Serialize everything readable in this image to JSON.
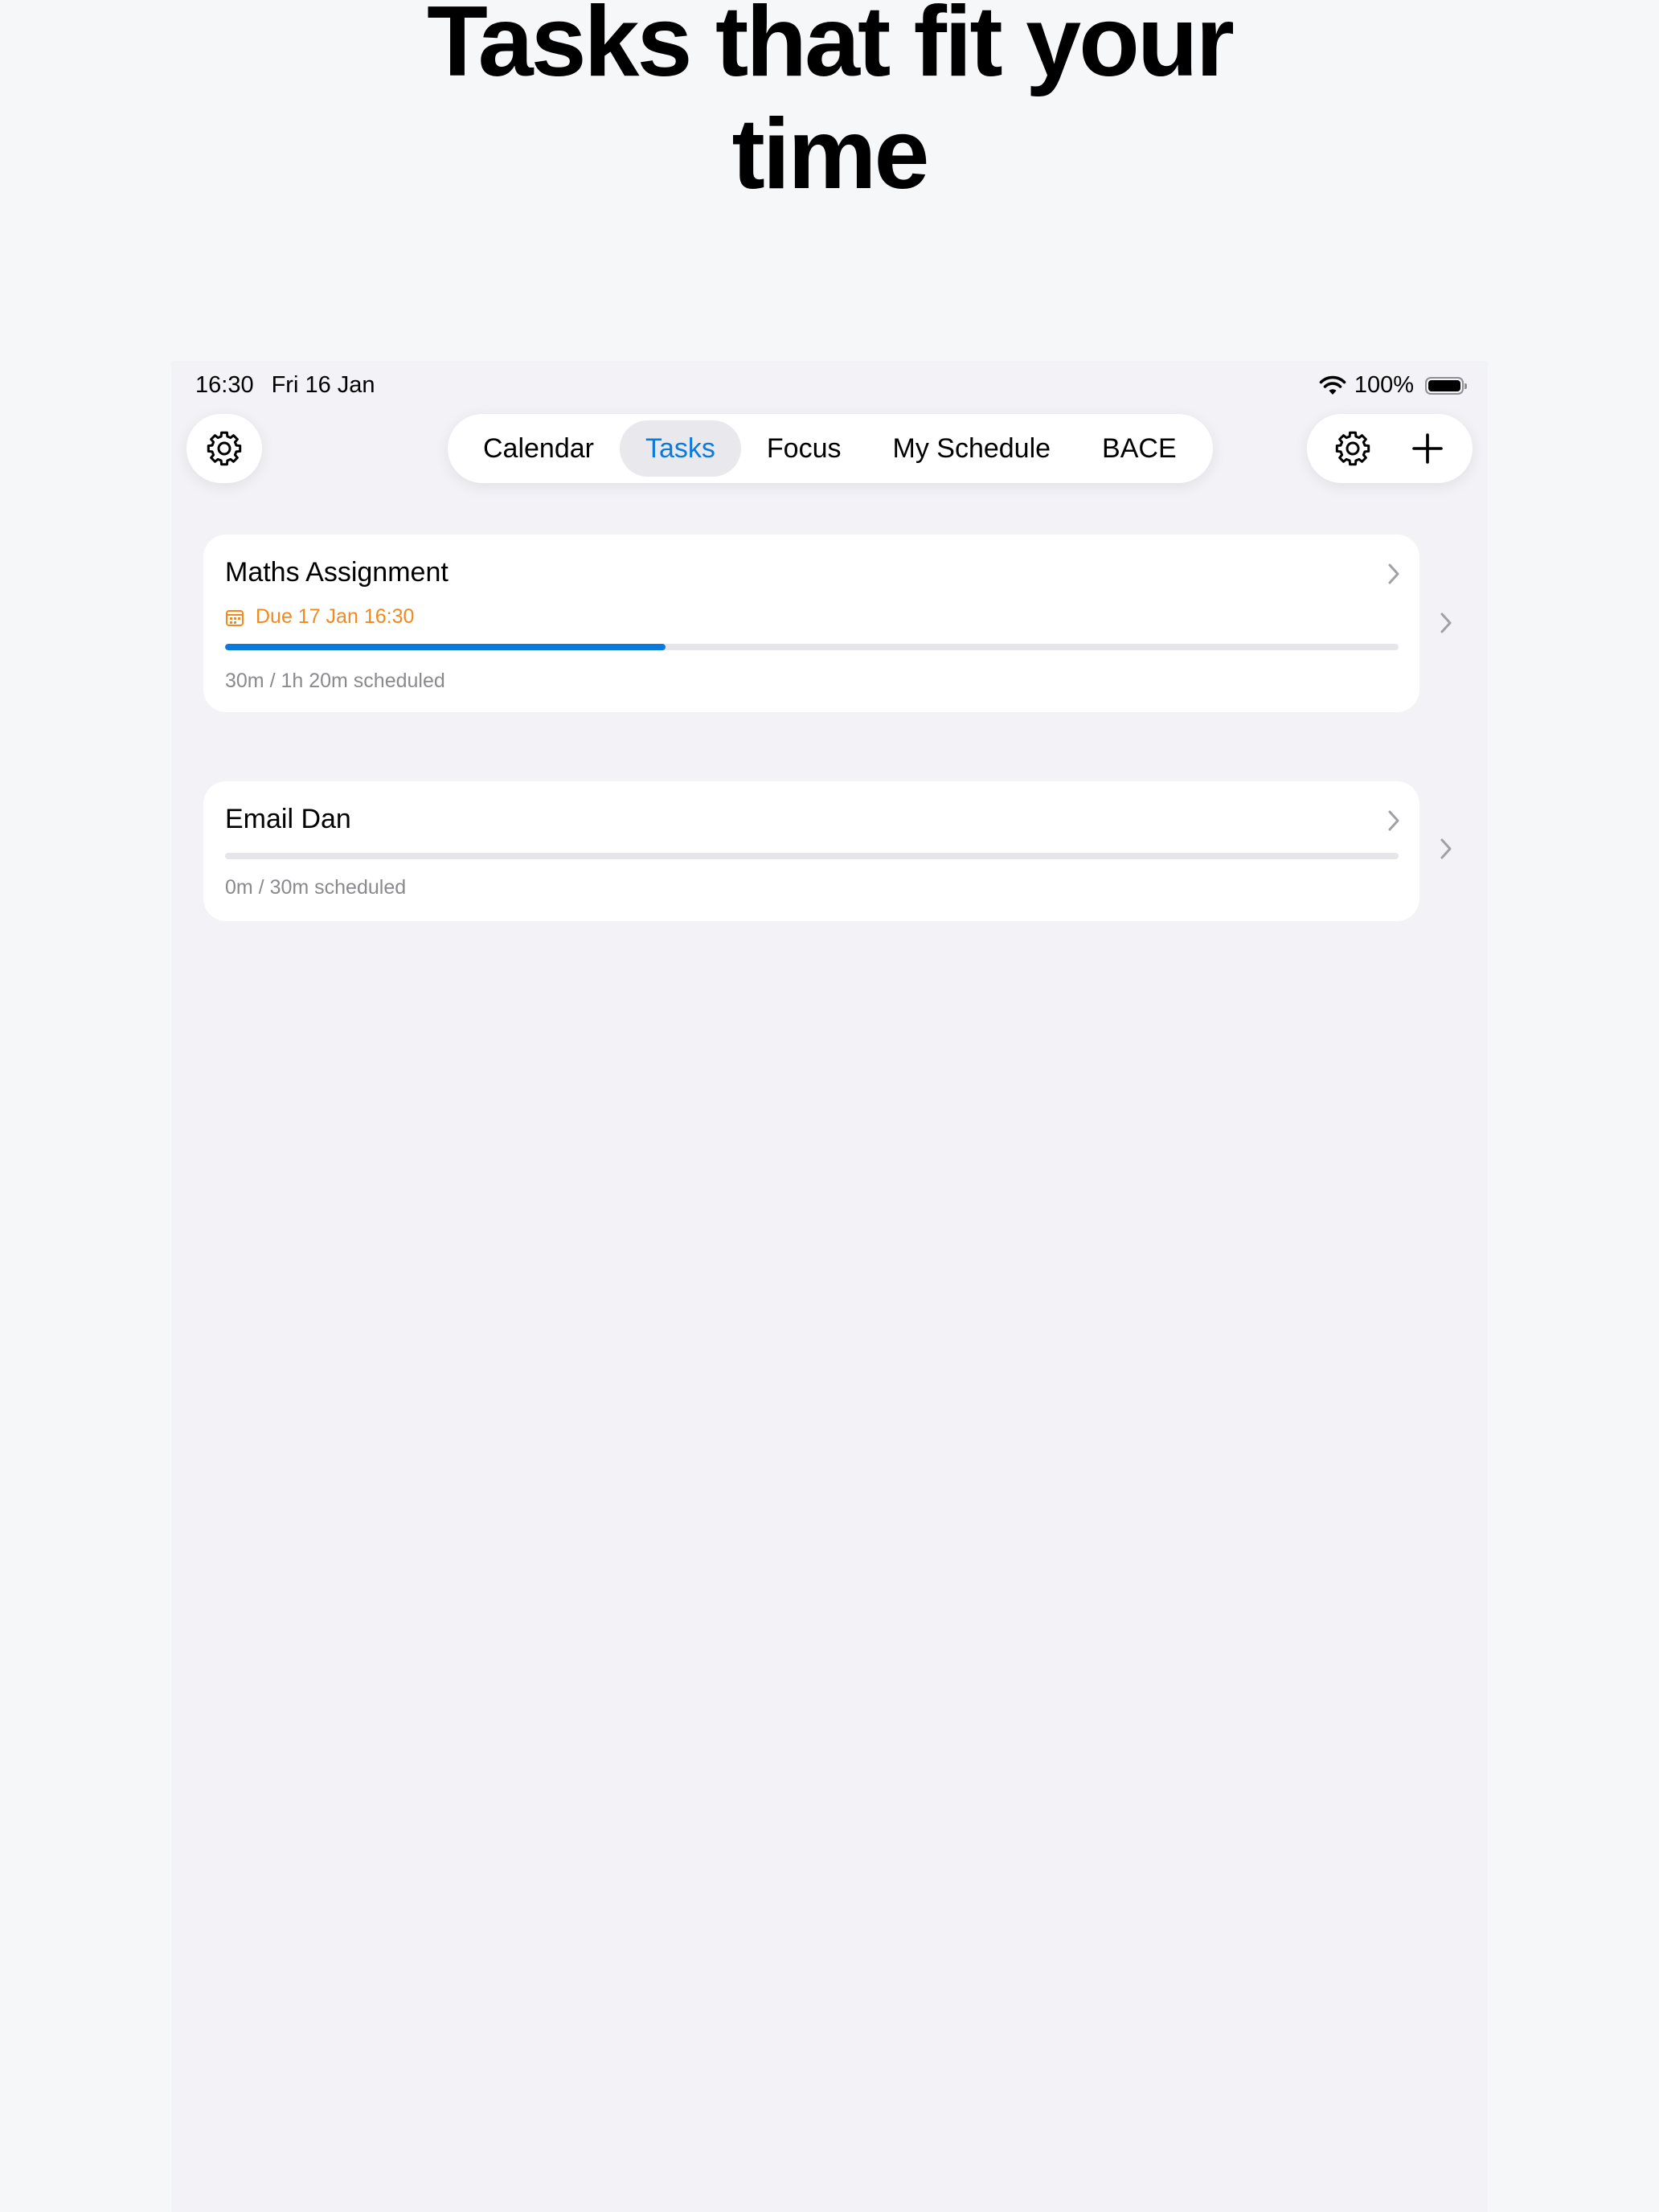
{
  "headline": {
    "line1": "Tasks that fit your",
    "line2": "time"
  },
  "status_bar": {
    "time": "16:30",
    "date": "Fri 16 Jan",
    "battery": "100%"
  },
  "icons": {
    "settings_left": "gear-icon",
    "settings_right": "gear-icon",
    "add": "plus-icon",
    "chevron": "chevron-right-icon",
    "calendar": "calendar-icon",
    "wifi": "wifi-icon",
    "battery": "battery-icon"
  },
  "tabs": [
    {
      "label": "Calendar",
      "active": false
    },
    {
      "label": "Tasks",
      "active": true
    },
    {
      "label": "Focus",
      "active": false
    },
    {
      "label": "My Schedule",
      "active": false
    },
    {
      "label": "BACE",
      "active": false
    }
  ],
  "colors": {
    "accent": "#0a7bdc",
    "due": "#f0891f",
    "secondary_text": "#8a8a8e"
  },
  "tasks": [
    {
      "title": "Maths Assignment",
      "due": "Due 17 Jan  16:30",
      "progress": 0.375,
      "scheduled": "30m / 1h 20m scheduled"
    },
    {
      "title": "Email Dan",
      "progress": 0,
      "scheduled": "0m / 30m scheduled"
    }
  ]
}
